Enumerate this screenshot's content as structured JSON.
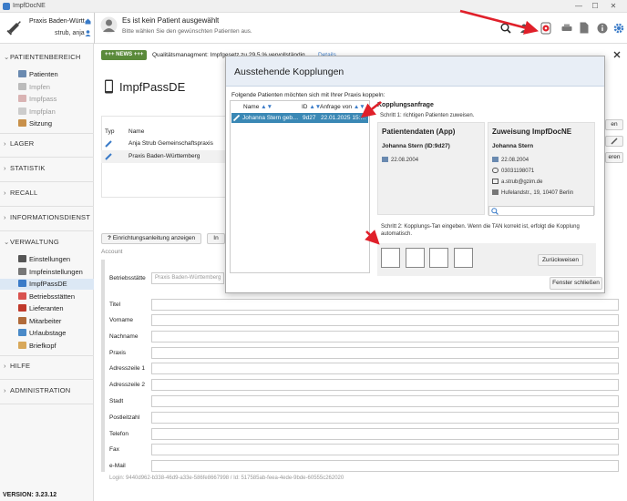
{
  "window": {
    "title": "ImpfDocNE",
    "controls": [
      "—",
      "☐",
      "✕"
    ]
  },
  "header": {
    "practice": "Praxis Baden-Württ…",
    "user": "strub, anja",
    "patient_title": "Es ist kein Patient ausgewählt",
    "patient_sub": "Bitte wählen Sie den gewünschten Patienten aus.",
    "toolbar_icons": [
      "search-icon",
      "user-transfer-icon",
      "coupling-icon",
      "print-icon",
      "document-icon",
      "info-icon",
      "gear-icon"
    ]
  },
  "sidebar": {
    "sections": [
      {
        "label": "PATIENTENBEREICH",
        "expanded": true
      },
      {
        "label": "LAGER"
      },
      {
        "label": "STATISTIK"
      },
      {
        "label": "RECALL"
      },
      {
        "label": "INFORMATIONSDIENST"
      },
      {
        "label": "VERWALTUNG",
        "expanded": true
      },
      {
        "label": "HILFE"
      },
      {
        "label": "ADMINISTRATION"
      }
    ],
    "patient_items": [
      "Patienten",
      "Impfen",
      "Impfpass",
      "Impfplan",
      "Sitzung"
    ],
    "admin_items": [
      "Einstellungen",
      "Impfeinstellungen",
      "ImpfPassDE",
      "Betriebsstätten",
      "Lieferanten",
      "Mitarbeiter",
      "Urlaubstage",
      "Briefkopf"
    ],
    "version": "VERSION: 3.23.12"
  },
  "news": {
    "badge": "+++ NEWS +++",
    "text": "Qualitätsmanagment: Impfgesetz zu 29.5 % vervollständig",
    "link": "Details"
  },
  "main": {
    "title": "ImpfPassDE",
    "table": {
      "headers": [
        "Typ",
        "Name"
      ],
      "rows": [
        {
          "name": "Anja Strub Gemeinschaftspraxis Fr…"
        },
        {
          "name": "Praxis Baden-Württemberg"
        }
      ]
    },
    "setup_button": "Einrichtungsanleitung anzeigen",
    "second_button": "In",
    "side_buttons": [
      "en",
      "eren"
    ],
    "account_label": "Account",
    "fields": {
      "betriebsstaette_label": "Betriebsstätte",
      "betriebsstaette_value": "Praxis Baden-Württemberg",
      "labels": [
        "Titel",
        "Vorname",
        "Nachname",
        "Praxis",
        "Adresszeile 1",
        "Adresszeile 2",
        "Stadt",
        "Postleitzahl",
        "Telefon",
        "Fax",
        "e-Mail"
      ]
    },
    "login_line": "Login: 9440d962-b338-46d9-a33e-586fe8667998 / Id: 517585ab-feea-4ede-9bde-60555c262020"
  },
  "modal": {
    "title": "Ausstehende Kopplungen",
    "intro": "Folgende Patienten möchten sich mit Ihrer Praxis koppeln:",
    "list_headers": [
      "Name",
      "ID",
      "Anfrage von"
    ],
    "list_row": {
      "name": "Johanna Stern geb…",
      "id": "9d27",
      "date": "22.01.2025 15:…"
    },
    "request_title": "Kopplungsanfrage",
    "step1": "Schritt 1: richtigen Patienten zuweisen.",
    "app_card": {
      "heading": "Patientendaten (App)",
      "name": "Johanna Stern (ID:9d27)",
      "birthdate": "22.08.2004"
    },
    "assign_card": {
      "heading": "Zuweisung ImpfDocNE",
      "name": "Johanna Stern",
      "birthdate": "22.08.2004",
      "phone": "03031198071",
      "email": "a.strub@gzim.de",
      "address": "Hufelandstr., 19, 10407 Berlin"
    },
    "step2": "Schritt 2: Kopplungs-Tan eingeben. Wenn die TAN korrekt ist, erfolgt die Kopplung automatisch.",
    "reject_button": "Zurückweisen",
    "close_button": "Fenster schließen"
  },
  "colors": {
    "accent": "#3a7bc8",
    "selection": "#3a88b5",
    "arrow": "#e0202a",
    "news": "#5a8a3a"
  }
}
